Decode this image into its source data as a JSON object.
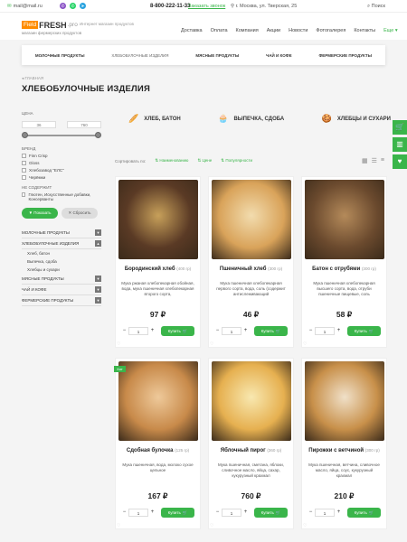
{
  "topbar": {
    "email": "mail@mail.ru",
    "phone": "8-800-222-11-33",
    "callback": "Заказать звонок",
    "address": "г. Москва, ул. Тверская, 25",
    "search": "Поиск"
  },
  "header": {
    "logo_a": "Field",
    "logo_b": "FRESH",
    "logo_c": ".pro",
    "tagline": "магазин фермерских продуктов",
    "slogan": "Интернет магазин продуктов"
  },
  "nav": [
    "Доставка",
    "Оплата",
    "Компания",
    "Акции",
    "Новости",
    "Фотогалерея",
    "Контакты"
  ],
  "nav_more": "Еще ▾",
  "catbar": [
    "МОЛОЧНЫЕ ПРОДУКТЫ",
    "ХЛЕБОБУЛОЧНЫЕ ИЗДЕЛИЯ",
    "МЯСНЫЕ ПРОДУКТЫ",
    "ЧАЙ И КОФЕ",
    "ФЕРМЕРСКИЕ ПРОДУКТЫ"
  ],
  "breadcrumb": "ГЛАВНАЯ",
  "title": "ХЛЕБОБУЛОЧНЫЕ ИЗДЕЛИЯ",
  "filter": {
    "price_label": "ЦЕНА",
    "price_from": "36",
    "price_to": "760",
    "brand_label": "БРЕНД",
    "brands": [
      "Finn Crisp",
      "Gloss",
      "Хлебозавод \"ЕЛС\"",
      "Черёмки"
    ],
    "excl_label": "НЕ СОДЕРЖИТ",
    "excl": [
      "Глютен, Искусственные добавки, Консерванты"
    ],
    "show": "Показать",
    "reset": "Сбросить"
  },
  "menu": [
    {
      "label": "МОЛОЧНЫЕ ПРОДУКТЫ"
    },
    {
      "label": "ХЛЕБОБУЛОЧНЫЕ ИЗДЕЛИЯ",
      "open": true,
      "sub": [
        "Хлеб, батон",
        "Выпечка, сдоба",
        "Хлебцы и сухари"
      ]
    },
    {
      "label": "МЯСНЫЕ ПРОДУКТЫ"
    },
    {
      "label": "ЧАЙ И КОФЕ"
    },
    {
      "label": "ФЕРМЕРСКИЕ ПРОДУКТЫ"
    }
  ],
  "subcats": [
    {
      "icon": "🥖",
      "label": "ХЛЕБ, БАТОН"
    },
    {
      "icon": "🧁",
      "label": "ВЫПЕЧКА, СДОБА"
    },
    {
      "icon": "🍪",
      "label": "ХЛЕБЦЫ И СУХАРИ"
    }
  ],
  "sort": {
    "label": "Сортировать по:",
    "options": [
      "Наименованию",
      "Цене",
      "Популярности"
    ]
  },
  "products": [
    {
      "name": "Бородинский хлеб",
      "weight": "(400 гр)",
      "desc": "Мука ржаная хлебопекарная обойная, вода, мука пшеничная хлебопекарная второго сорта,",
      "price": "97 ₽",
      "qty": "1",
      "buy": "Купить",
      "color": "#5a3a25",
      "color2": "#c7a05a"
    },
    {
      "name": "Пшеничный хлеб",
      "weight": "(300 гр)",
      "desc": "Мука пшеничная хлебопекарная первого сорта, вода, соль (содержит антислеживающий",
      "price": "46 ₽",
      "qty": "1",
      "buy": "Купить",
      "color": "#d9a35a",
      "color2": "#f2dcae"
    },
    {
      "name": "Батон с отрубями",
      "weight": "(300 гр)",
      "desc": "Мука пшеничная хлебопекарная высшего сорта, вода, отруби пшеничные пищевые, соль",
      "price": "58 ₽",
      "qty": "1",
      "buy": "Купить",
      "color": "#6b4a2e",
      "color2": "#b48a5a"
    },
    {
      "name": "Сдобная булочка",
      "weight": "(125 гр)",
      "desc": "Мука пшеничная, вода, молоко сухое цельное",
      "price": "167 ₽",
      "qty": "1",
      "buy": "Купить",
      "badge": "Хит",
      "color": "#c88a4a",
      "color2": "#eec99a"
    },
    {
      "name": "Яблочный пирог",
      "weight": "(360 гр)",
      "desc": "Мука пшеничная, сметана, яблоки, сливочное масло, яйца, сахар, кукурузный крахмал",
      "price": "760 ₽",
      "qty": "1",
      "buy": "Купить",
      "color": "#e6b050",
      "color2": "#f8e8b0"
    },
    {
      "name": "Пирожки с ветчиной",
      "weight": "(300 гр)",
      "desc": "Мука пшеничная, ветчина, сливочное масло, яйца, соус, кукурузный крахмал",
      "price": "210 ₽",
      "qty": "1",
      "buy": "Купить",
      "color": "#c8904a",
      "color2": "#f0e0c8"
    }
  ],
  "accent": "#3ab54a"
}
